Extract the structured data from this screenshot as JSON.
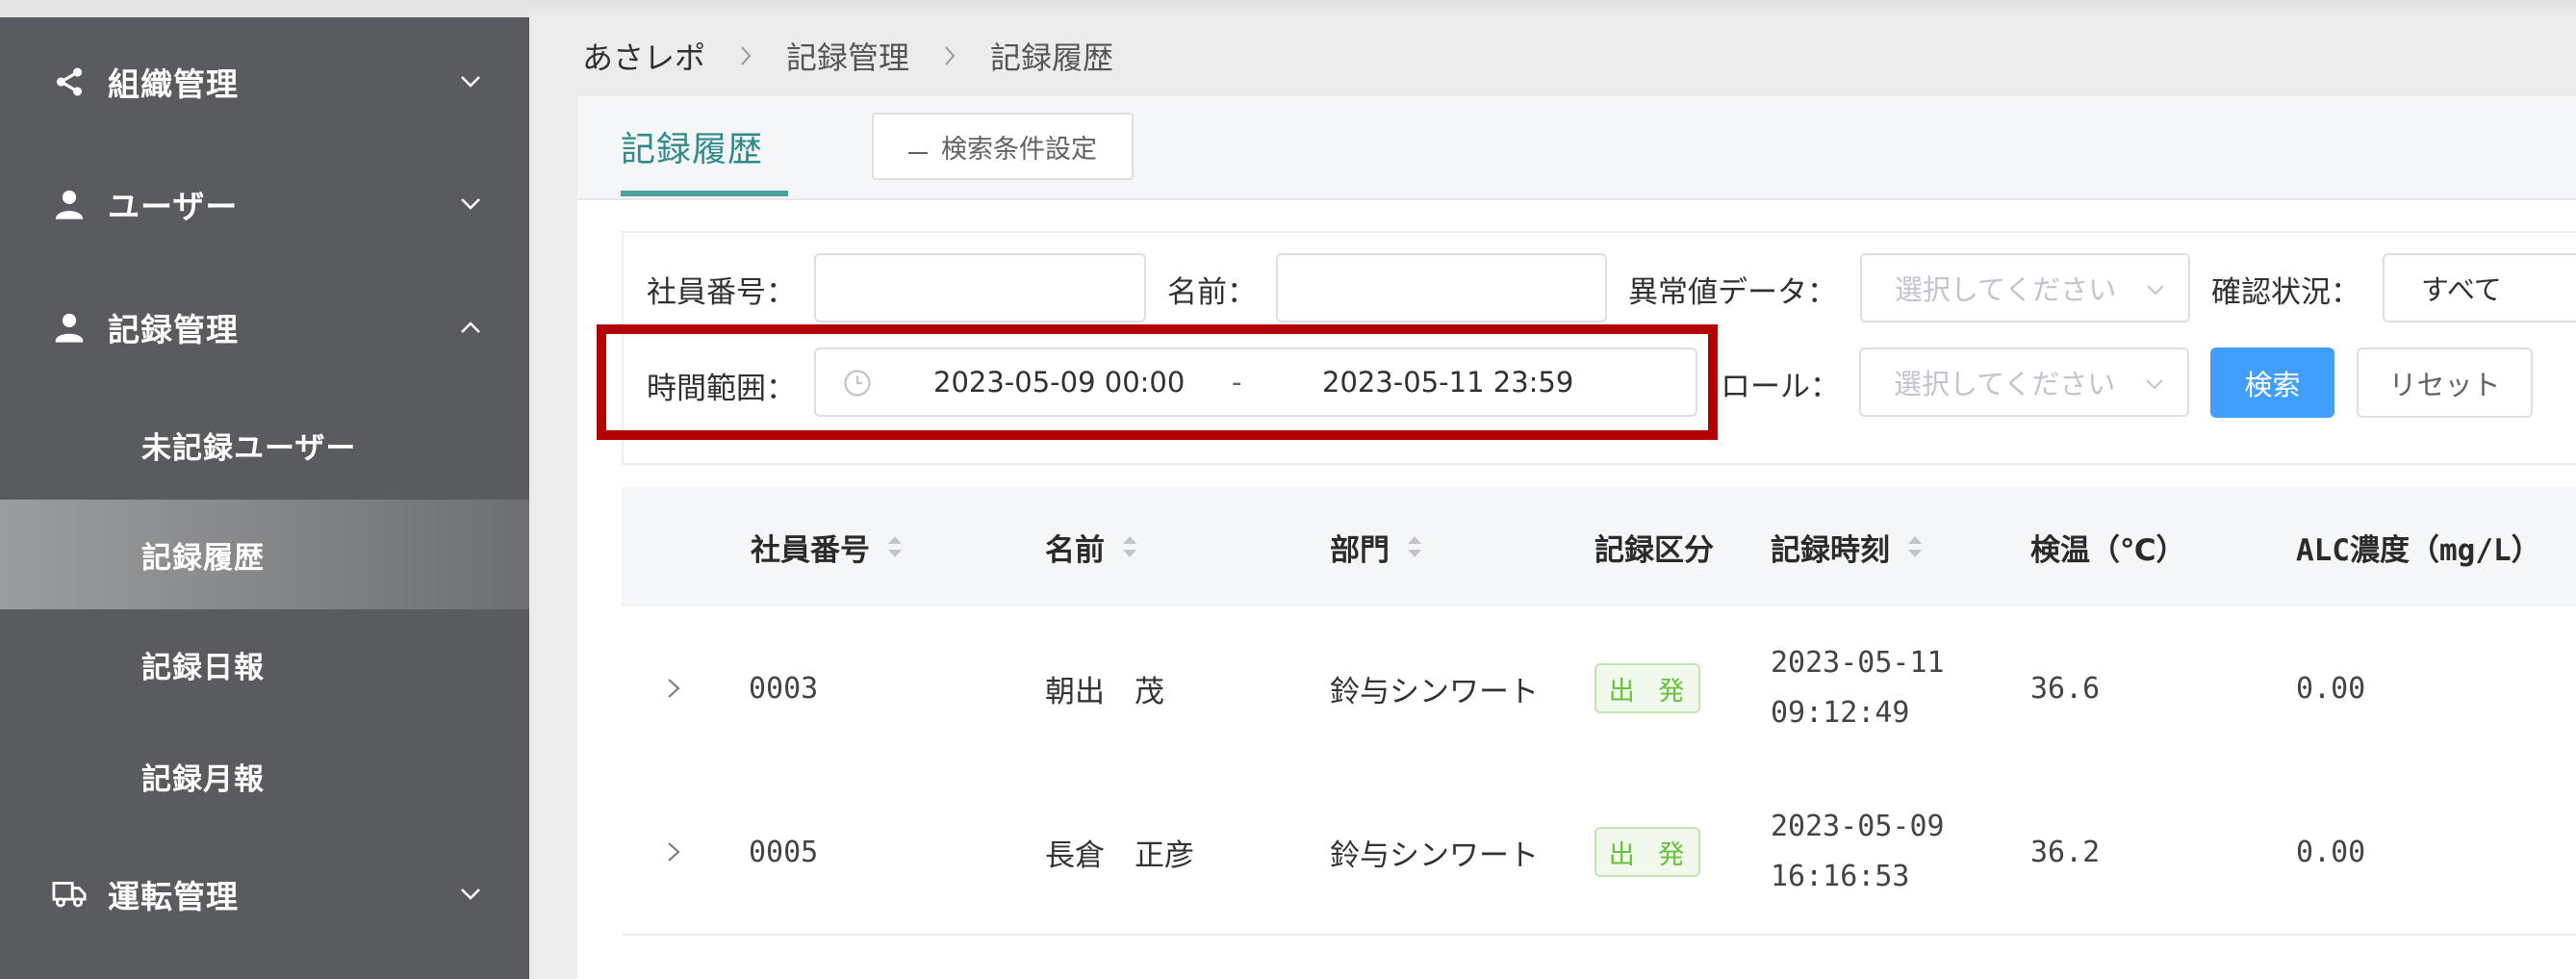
{
  "sidebar": {
    "menus": [
      {
        "label": "組織管理",
        "icon": "share-icon",
        "expanded": false
      },
      {
        "label": "ユーザー",
        "icon": "user-icon",
        "expanded": false
      },
      {
        "label": "記録管理",
        "icon": "user-badge-icon",
        "expanded": true
      },
      {
        "label": "運転管理",
        "icon": "truck-icon",
        "expanded": false
      }
    ],
    "sub_items": [
      {
        "label": "未記録ユーザー",
        "active": false
      },
      {
        "label": "記録履歴",
        "active": true
      },
      {
        "label": "記録日報",
        "active": false
      },
      {
        "label": "記録月報",
        "active": false
      }
    ]
  },
  "breadcrumb": [
    "あさレポ",
    "記録管理",
    "記録履歴"
  ],
  "tab": {
    "label": "記録履歴"
  },
  "condition_button": {
    "label": "検索条件設定"
  },
  "filters": {
    "employee_no": {
      "label": "社員番号：",
      "value": ""
    },
    "name": {
      "label": "名前：",
      "value": ""
    },
    "abnormal": {
      "label": "異常値データ：",
      "placeholder": "選択してください"
    },
    "confirm": {
      "label": "確認状況：",
      "value": "すべて"
    },
    "time_range": {
      "label": "時間範囲：",
      "start": "2023-05-09 00:00",
      "separator": "-",
      "end": "2023-05-11 23:59"
    },
    "role": {
      "label": "ロール：",
      "placeholder": "選択してください"
    },
    "search_label": "検索",
    "reset_label": "リセット"
  },
  "table": {
    "headers": [
      "社員番号",
      "名前",
      "部門",
      "記録区分",
      "記録時刻",
      "検温（℃）",
      "ALC濃度（mg/L）"
    ],
    "rows": [
      {
        "employee_no": "0003",
        "name": "朝出　茂",
        "dept": "鈴与シンワート",
        "category": "出 発",
        "date": "2023-05-11",
        "time": "09:12:49",
        "temp": "36.6",
        "alc": "0.00"
      },
      {
        "employee_no": "0005",
        "name": "長倉　正彦",
        "dept": "鈴与シンワート",
        "category": "出 発",
        "date": "2023-05-09",
        "time": "16:16:53",
        "temp": "36.2",
        "alc": "0.00"
      }
    ]
  },
  "colors": {
    "sidebar": "#5a5b5e",
    "accent": "#2e8b8b",
    "primary": "#409eff",
    "highlight": "#b30000",
    "tag_green": "#67c23a"
  }
}
